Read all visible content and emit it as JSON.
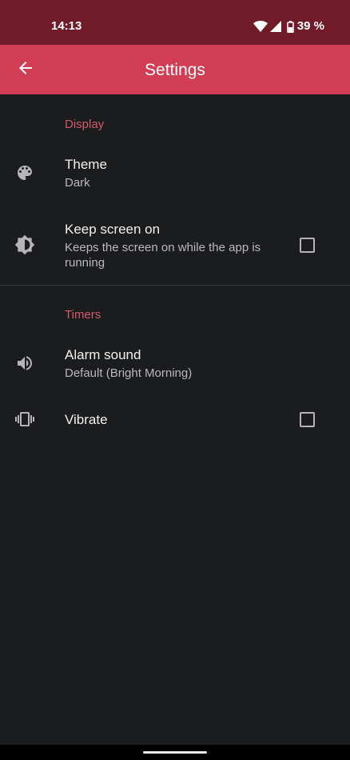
{
  "status_bar": {
    "time": "14:13",
    "battery_text": "39 %",
    "icons": [
      "wifi-icon",
      "signal-icon",
      "battery-icon"
    ]
  },
  "app_bar": {
    "title": "Settings",
    "back_icon": "arrow-back-icon"
  },
  "sections": {
    "display": {
      "header": "Display",
      "theme": {
        "icon": "palette-icon",
        "title": "Theme",
        "summary": "Dark"
      },
      "keep_screen_on": {
        "icon": "brightness-icon",
        "title": "Keep screen on",
        "summary": "Keeps the screen on while the app is running",
        "checked": false
      }
    },
    "timers": {
      "header": "Timers",
      "alarm_sound": {
        "icon": "volume-icon",
        "title": "Alarm sound",
        "summary": "Default (Bright Morning)"
      },
      "vibrate": {
        "icon": "vibrate-icon",
        "title": "Vibrate",
        "checked": false
      }
    }
  },
  "colors": {
    "status_bar": "#721b28",
    "app_bar": "#d13d54",
    "accent": "#d4596c",
    "background": "#1b1c1e"
  }
}
